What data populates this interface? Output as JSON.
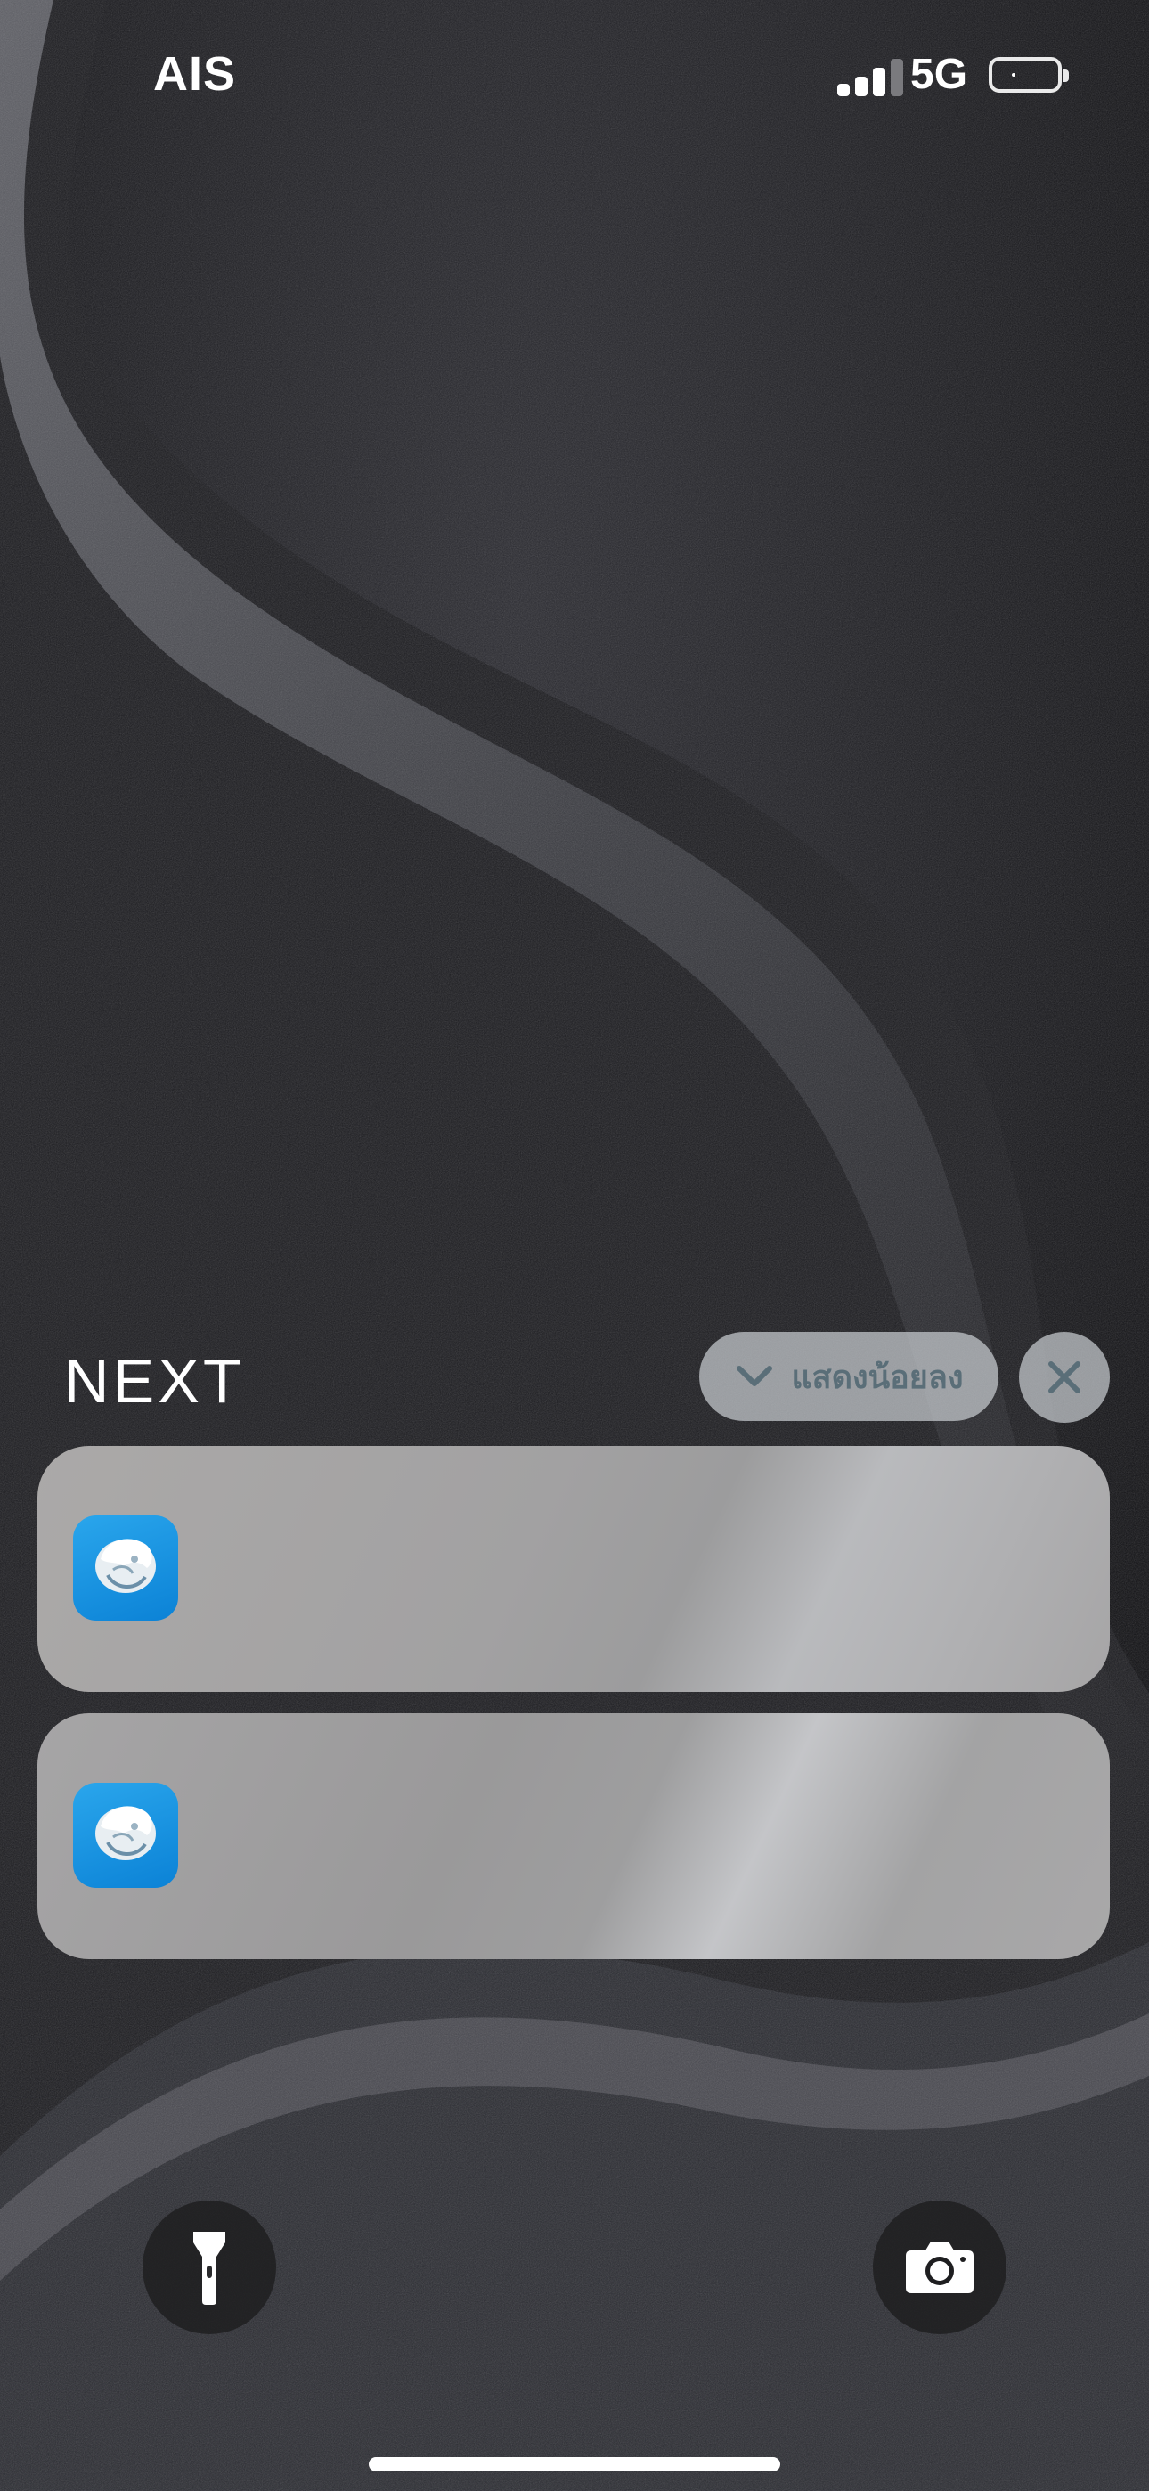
{
  "status_bar": {
    "carrier": "AIS",
    "network": "5G",
    "signal_bars_active": 3,
    "signal_bars_total": 4
  },
  "notification_group": {
    "title": "NEXT",
    "show_less_label": "แสดงน้อยลง",
    "notifications": [
      {
        "app_icon": "krungthai-next-app-icon"
      },
      {
        "app_icon": "krungthai-next-app-icon"
      }
    ]
  },
  "quick_actions": {
    "left": "flashlight-icon",
    "right": "camera-icon"
  },
  "colors": {
    "notification_bg": "#a3a2a3",
    "pill_bg": "#c8ccd0",
    "pill_text": "#5a6e78",
    "app_icon_blue": "#1495e2"
  }
}
